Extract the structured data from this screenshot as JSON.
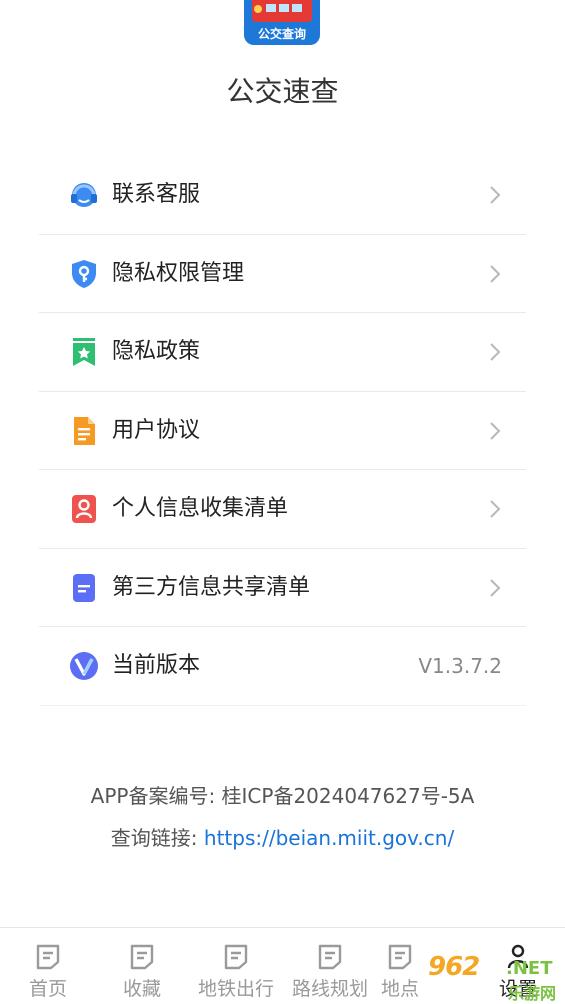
{
  "app": {
    "logo_text": "公交查询",
    "name": "公交速查"
  },
  "menu": {
    "items": [
      {
        "label": "联系客服",
        "icon": "headset-icon"
      },
      {
        "label": "隐私权限管理",
        "icon": "shield-key-icon"
      },
      {
        "label": "隐私政策",
        "icon": "bookmark-star-icon"
      },
      {
        "label": "用户协议",
        "icon": "document-icon"
      },
      {
        "label": "个人信息收集清单",
        "icon": "person-card-icon"
      },
      {
        "label": "第三方信息共享清单",
        "icon": "list-doc-icon"
      }
    ],
    "version": {
      "label": "当前版本",
      "value": "V1.3.7.2",
      "icon": "v-badge-icon"
    }
  },
  "footer": {
    "beian": "APP备案编号: 桂ICP备2024047627号-5A",
    "query_prefix": "查询链接: ",
    "query_url": "https://beian.miit.gov.cn/"
  },
  "tabbar": {
    "tabs": [
      {
        "label": "首页"
      },
      {
        "label": "收藏"
      },
      {
        "label": "地铁出行"
      },
      {
        "label": "路线规划"
      },
      {
        "label": "地点"
      },
      {
        "label": "设置"
      }
    ]
  },
  "watermark": {
    "logo": "962",
    "net": ".NET",
    "sub": "乐游网"
  },
  "colors": {
    "accent_blue": "#1a73d9",
    "icon_blue": "#3d8bf2",
    "icon_green": "#2fbf71",
    "icon_orange": "#f59a23",
    "icon_red": "#ef5350",
    "icon_indigo": "#5b6ef5"
  }
}
